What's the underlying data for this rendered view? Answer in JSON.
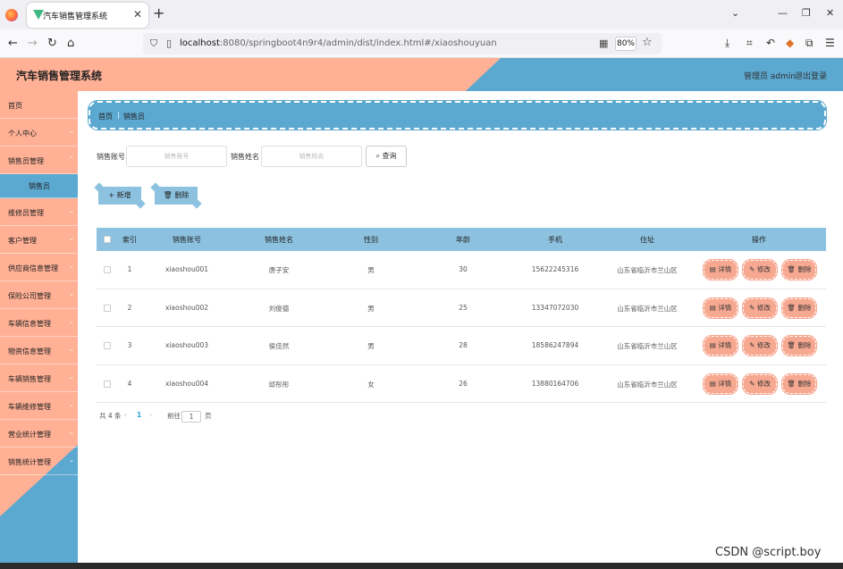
{
  "browser": {
    "tab_title": "汽车销售管理系统",
    "url_host": "localhost",
    "url_rest": ":8080/springboot4n9r4/admin/dist/index.html#/xiaoshouyuan",
    "zoom": "80%"
  },
  "header": {
    "title": "汽车销售管理系统",
    "admin": "管理员 admin",
    "logout": "退出登录"
  },
  "sidebar": {
    "items": [
      {
        "label": "首页",
        "chevron": false
      },
      {
        "label": "个人中心",
        "chevron": true
      },
      {
        "label": "销售员管理",
        "chevron": true
      },
      {
        "label": "销售员",
        "sub": true
      },
      {
        "label": "维修员管理",
        "chevron": true
      },
      {
        "label": "客户管理",
        "chevron": true
      },
      {
        "label": "供应商信息管理",
        "chevron": true
      },
      {
        "label": "保险公司管理",
        "chevron": true
      },
      {
        "label": "车辆信息管理",
        "chevron": true
      },
      {
        "label": "物资信息管理",
        "chevron": true
      },
      {
        "label": "车辆销售管理",
        "chevron": true
      },
      {
        "label": "车辆维修管理",
        "chevron": true
      },
      {
        "label": "营业统计管理",
        "chevron": true
      },
      {
        "label": "销售统计管理",
        "chevron": true
      }
    ]
  },
  "breadcrumb": {
    "home": "首页",
    "current": "销售员"
  },
  "filters": {
    "account_label": "销售账号",
    "account_placeholder": "销售账号",
    "name_label": "销售姓名",
    "name_placeholder": "销售姓名",
    "search_label": "查询"
  },
  "actions": {
    "add": "新增",
    "delete": "删除"
  },
  "table": {
    "headers": [
      "索引",
      "销售账号",
      "销售姓名",
      "性别",
      "年龄",
      "手机",
      "住址",
      "操作"
    ],
    "rows": [
      {
        "index": "1",
        "account": "xiaoshou001",
        "name": "唐子安",
        "gender": "男",
        "age": "30",
        "phone": "15622245316",
        "address": "山东省临沂市兰山区"
      },
      {
        "index": "2",
        "account": "xiaoshou002",
        "name": "刘俊德",
        "gender": "男",
        "age": "25",
        "phone": "13347072030",
        "address": "山东省临沂市兰山区"
      },
      {
        "index": "3",
        "account": "xiaoshou003",
        "name": "侯佳然",
        "gender": "男",
        "age": "28",
        "phone": "18586247894",
        "address": "山东省临沂市兰山区"
      },
      {
        "index": "4",
        "account": "xiaoshou004",
        "name": "邱彤彤",
        "gender": "女",
        "age": "26",
        "phone": "13880164706",
        "address": "山东省临沂市兰山区"
      }
    ],
    "row_buttons": {
      "detail": "详情",
      "edit": "修改",
      "delete": "删除"
    }
  },
  "pagination": {
    "total": "共 4 条",
    "current_page": "1",
    "goto_label": "前往",
    "goto_value": "1",
    "page_unit": "页"
  },
  "watermark": "CSDN @script.boy",
  "colors": {
    "salmon": "#ffb095",
    "blue": "#5ba8d0",
    "light_blue": "#8cc2e0",
    "button_salmon": "#f7a891"
  }
}
